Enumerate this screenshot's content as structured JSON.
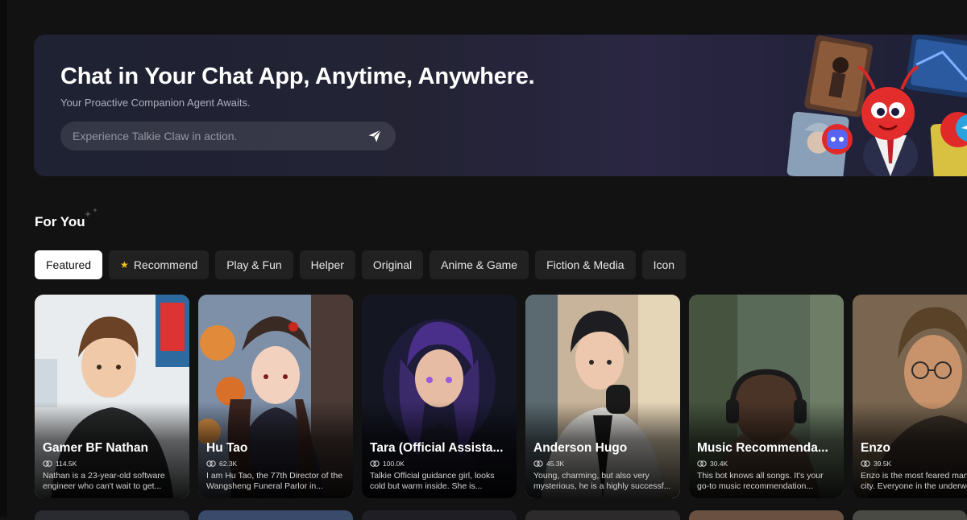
{
  "hero": {
    "title": "Chat in Your Chat App, Anytime, Anywhere.",
    "subtitle": "Your Proactive Companion Agent Awaits.",
    "input_placeholder": "Experience Talkie Claw in action.",
    "send_icon": "send-icon"
  },
  "section": {
    "title": "For You"
  },
  "tabs": [
    "Featured",
    "Recommend",
    "Play & Fun",
    "Helper",
    "Original",
    "Anime & Game",
    "Fiction & Media",
    "Icon"
  ],
  "cards": [
    {
      "name": "Gamer BF Nathan",
      "count": "114.5K",
      "desc": "Nathan is a 23-year-old software engineer who can't wait to get..."
    },
    {
      "name": "Hu Tao",
      "count": "62.3K",
      "desc": "I am Hu Tao, the 77th Director of the Wangsheng Funeral Parlor in..."
    },
    {
      "name": "Tara (Official Assista...",
      "count": "100.0K",
      "desc": "Talkie Official guidance girl, looks cold but warm inside. She is..."
    },
    {
      "name": "Anderson Hugo",
      "count": "45.3K",
      "desc": "Young, charming, but also very mysterious, he is a highly successf..."
    },
    {
      "name": "Music Recommenda...",
      "count": "30.4K",
      "desc": "This bot knows all songs. It's your go-to music recommendation..."
    },
    {
      "name": "Enzo",
      "count": "39.5K",
      "desc": "Enzo is the most feared man in the city. Everyone in the underworld..."
    }
  ],
  "colors": {
    "background": "#131212",
    "tab_active": "#ffffff",
    "tab_bg": "#222122",
    "star": "#f5c518"
  }
}
